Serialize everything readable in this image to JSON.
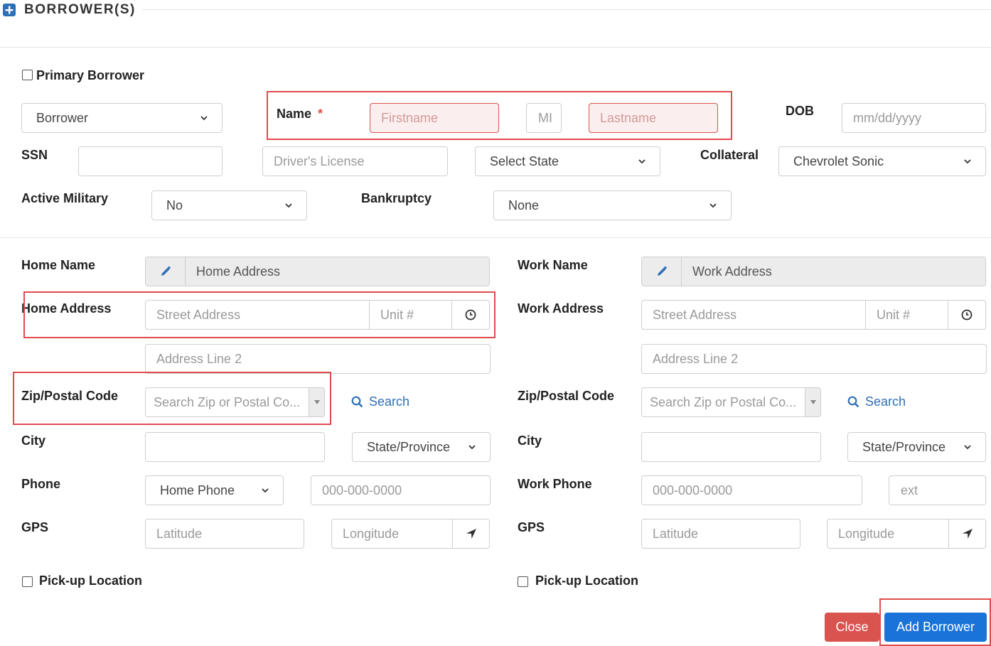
{
  "section": {
    "title": "BORROWER(S)",
    "icon": "plus-square-icon"
  },
  "primary_borrower": {
    "label": "Primary Borrower",
    "checked": false
  },
  "borrower_type": {
    "value": "Borrower"
  },
  "name": {
    "label": "Name",
    "required_mark": "*",
    "firstname_placeholder": "Firstname",
    "mi_placeholder": "MI",
    "lastname_placeholder": "Lastname"
  },
  "dob": {
    "label": "DOB",
    "placeholder": "mm/dd/yyyy"
  },
  "ssn": {
    "label": "SSN",
    "value": ""
  },
  "drivers_license": {
    "placeholder": "Driver's License"
  },
  "dl_state": {
    "value": "Select State"
  },
  "collateral": {
    "label": "Collateral",
    "value": "Chevrolet Sonic"
  },
  "active_military": {
    "label": "Active Military",
    "value": "No"
  },
  "bankruptcy": {
    "label": "Bankruptcy",
    "value": "None"
  },
  "home": {
    "name_label": "Home Name",
    "name_value": "Home Address",
    "address_label": "Home Address",
    "street_placeholder": "Street Address",
    "unit_placeholder": "Unit #",
    "line2_placeholder": "Address Line 2",
    "zip_label": "Zip/Postal Code",
    "zip_placeholder": "Search Zip or Postal Co...",
    "search_label": "Search",
    "city_label": "City",
    "city_value": "",
    "state_value": "State/Province",
    "phone_label": "Phone",
    "phone_type": "Home Phone",
    "phone_placeholder": "000-000-0000",
    "gps_label": "GPS",
    "lat_placeholder": "Latitude",
    "lon_placeholder": "Longitude",
    "pickup_label": "Pick-up Location"
  },
  "work": {
    "name_label": "Work Name",
    "name_value": "Work Address",
    "address_label": "Work Address",
    "street_placeholder": "Street Address",
    "unit_placeholder": "Unit #",
    "line2_placeholder": "Address Line 2",
    "zip_label": "Zip/Postal Code",
    "zip_placeholder": "Search Zip or Postal Co...",
    "search_label": "Search",
    "city_label": "City",
    "city_value": "",
    "state_value": "State/Province",
    "phone_label": "Work Phone",
    "phone_placeholder": "000-000-0000",
    "ext_placeholder": "ext",
    "gps_label": "GPS",
    "lat_placeholder": "Latitude",
    "lon_placeholder": "Longitude",
    "pickup_label": "Pick-up Location"
  },
  "buttons": {
    "close": "Close",
    "add": "Add Borrower"
  },
  "colors": {
    "accent": "#1a73d9",
    "danger": "#d9534f",
    "link": "#2f6fb7",
    "highlight": "#e14b4f"
  }
}
